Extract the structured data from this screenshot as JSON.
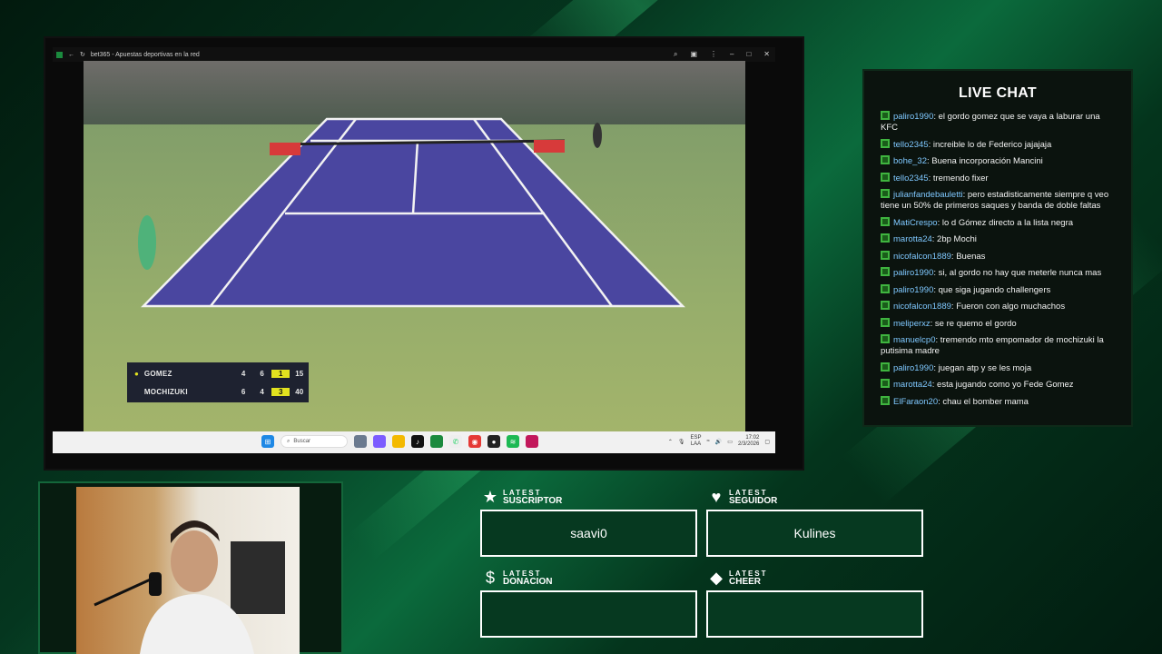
{
  "browser": {
    "tab_title": "bet365 - Apuestas deportivas en la red"
  },
  "scoreboard": {
    "players": [
      {
        "name": "GOMEZ",
        "serving": true,
        "sets": [
          "4",
          "6"
        ],
        "current_set": "1",
        "points": "15"
      },
      {
        "name": "MOCHIZUKI",
        "serving": false,
        "sets": [
          "6",
          "4"
        ],
        "current_set": "3",
        "points": "40"
      }
    ]
  },
  "taskbar": {
    "search_placeholder": "Buscar",
    "lang_top": "ESP",
    "lang_bottom": "LAA",
    "time": "17:02",
    "date": "2/3/2026"
  },
  "chat": {
    "title": "LIVE CHAT",
    "messages": [
      {
        "user": "paliro1990",
        "text": ": el gordo gomez que se vaya a laburar una KFC"
      },
      {
        "user": "tello2345",
        "text": ": increible lo de Federico jajajaja"
      },
      {
        "user": "bohe_32",
        "text": ": Buena incorporación Mancini"
      },
      {
        "user": "tello2345",
        "text": ": tremendo fixer"
      },
      {
        "user": "julianfandebauletti",
        "text": ": pero estadisticamente siempre q veo tiene un 50% de primeros saques y banda de doble faltas"
      },
      {
        "user": "MatiCrespo",
        "text": ": lo d Gómez directo a la lista negra"
      },
      {
        "user": "marotta24",
        "text": ": 2bp Mochi"
      },
      {
        "user": "nicofalcon1889",
        "text": ": Buenas"
      },
      {
        "user": "paliro1990",
        "text": ": si, al gordo no hay que meterle nunca mas"
      },
      {
        "user": "paliro1990",
        "text": ": que siga jugando challengers"
      },
      {
        "user": "nicofalcon1889",
        "text": ": Fueron con algo muchachos"
      },
      {
        "user": "meliperxz",
        "text": ": se re quemo el gordo"
      },
      {
        "user": "manuelcp0",
        "text": ": tremendo mto empomador de mochizuki la putisima madre"
      },
      {
        "user": "paliro1990",
        "text": ": juegan atp y se les moja"
      },
      {
        "user": "marotta24",
        "text": ": esta jugando como yo Fede Gomez"
      },
      {
        "user": "ElFaraon20",
        "text": ": chau el bomber mama"
      }
    ]
  },
  "widgets": {
    "suscriptor": {
      "label_top": "LATEST",
      "label_bottom": "SUSCRIPTOR",
      "value": "saavi0",
      "icon": "star-icon"
    },
    "seguidor": {
      "label_top": "LATEST",
      "label_bottom": "SEGUIDOR",
      "value": "Kulines",
      "icon": "heart-icon"
    },
    "donacion": {
      "label_top": "LATEST",
      "label_bottom": "DONACION",
      "value": "",
      "icon": "dollar-icon"
    },
    "cheer": {
      "label_top": "LATEST",
      "label_bottom": "CHEER",
      "value": "",
      "icon": "diamond-icon"
    }
  },
  "colors": {
    "accent_green": "#14663a",
    "chat_username": "#7fc8ff",
    "score_highlight": "#e2e21f",
    "court_blue": "#4a46a0"
  }
}
